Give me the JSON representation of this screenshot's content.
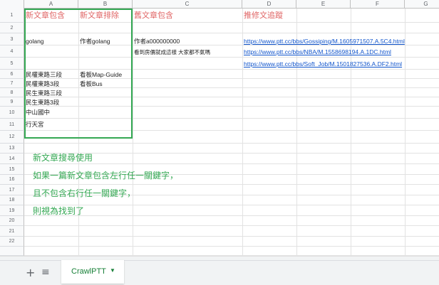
{
  "columns": [
    "A",
    "B",
    "C",
    "D",
    "E",
    "F",
    "G"
  ],
  "rows": [
    "1",
    "2",
    "3",
    "4",
    "5",
    "6",
    "7",
    "8",
    "9",
    "10",
    "11",
    "12",
    "13",
    "14",
    "15",
    "16",
    "17",
    "18",
    "19",
    "20",
    "21",
    "22"
  ],
  "cells": {
    "A1": "新文章包含",
    "B1": "新文章排除",
    "C1": "舊文章包含",
    "D1": "推修文追蹤",
    "A3": "golang",
    "B3": "作者golang",
    "C3": "作者a000000000",
    "D3": "https://www.ptt.cc/bbs/Gossiping/M.1605971507.A.5C4.html",
    "C4": "看到房價就成這樣 大家都不氣嗎",
    "D4": "https://www.ptt.cc/bbs/NBA/M.1558698194.A.1DC.html",
    "D5": "https://www.ptt.cc/bbs/Soft_Job/M.1501827536.A.DF2.html",
    "A6": "民權東路三段",
    "B6": "看板Map-Guide",
    "A7": "民權東路3段",
    "B7": "看板Bus",
    "A8": "民生東路三段",
    "A9": "民生東路3段",
    "A10": "中山國中",
    "A11": "行天宮"
  },
  "notes": [
    "新文章搜尋使用",
    "如果一篇新文章包含左行任一關鍵字，",
    "且不包含右行任一關鍵字，",
    "則視為找到了"
  ],
  "tabbar": {
    "add_icon": "+",
    "menu_icon": "≡",
    "sheet_name": "CrawlPTT",
    "caret": "▼"
  },
  "colors": {
    "header_red": "#e06666",
    "note_green": "#34a853",
    "link_blue": "#1155cc",
    "tab_green": "#188038"
  }
}
